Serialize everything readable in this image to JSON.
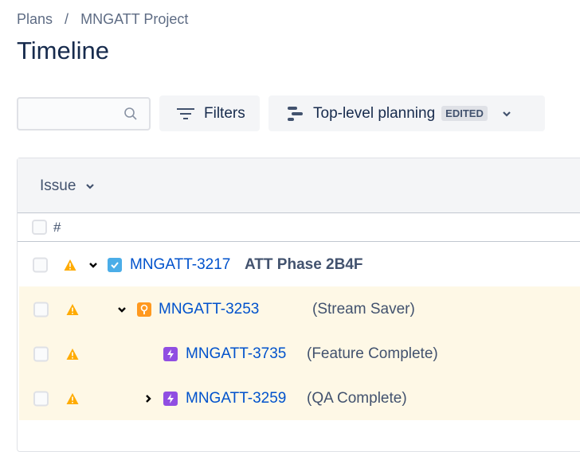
{
  "breadcrumb": {
    "root": "Plans",
    "sep": "/",
    "project": "MNGATT Project"
  },
  "page_title": "Timeline",
  "toolbar": {
    "search_placeholder": "",
    "filters_label": "Filters",
    "view_label": "Top-level planning",
    "view_badge": "EDITED"
  },
  "table": {
    "column_header": "Issue",
    "hash_label": "#",
    "rows": [
      {
        "key": "MNGATT-3217",
        "summary": "ATT Phase 2B4F",
        "type": "task",
        "expand": "expanded",
        "warning": true
      },
      {
        "key": "MNGATT-3253",
        "summary": "(Stream Saver)",
        "type": "idea",
        "expand": "expanded",
        "warning": true
      },
      {
        "key": "MNGATT-3735",
        "summary": "(Feature Complete)",
        "type": "epic",
        "expand": "none",
        "warning": true
      },
      {
        "key": "MNGATT-3259",
        "summary": "(QA Complete)",
        "type": "epic",
        "expand": "collapsed",
        "warning": true
      }
    ]
  },
  "colors": {
    "link": "#0052cc",
    "task": "#4bade8",
    "idea": "#ff991f",
    "epic": "#904ee2",
    "warning": "#ffab00",
    "highlight": "#fef8e6"
  }
}
